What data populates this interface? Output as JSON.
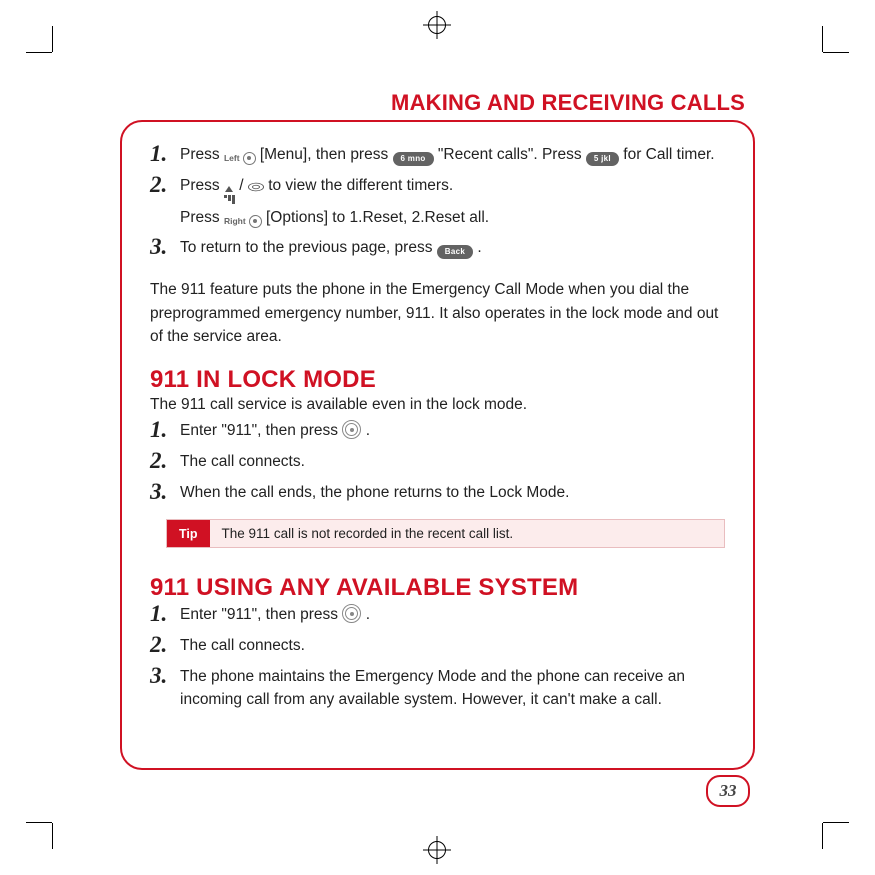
{
  "header": {
    "title": "MAKING AND RECEIVING CALLS"
  },
  "glyphs": {
    "left_soft": "Left",
    "right_soft": "Right",
    "key6": "6 mno",
    "key5": "5 jkl",
    "back": "Back"
  },
  "top_steps": {
    "s1": {
      "a": "Press",
      "b": "[Menu], then press",
      "c": "\"Recent calls\".  Press",
      "d": "for Call timer."
    },
    "s2": {
      "a": "Press",
      "b": "/",
      "c": "to view the different timers.",
      "sub_a": "Press",
      "sub_b": "[Options] to 1.Reset, 2.Reset all."
    },
    "s3": {
      "a": "To return to the previous page, press",
      "b": "."
    }
  },
  "intro_para": "The 911 feature puts the phone in the Emergency Call Mode when you dial the preprogrammed emergency number, 911.  It also operates in the lock mode and out of the service area.",
  "section_lock": {
    "title": "911 IN LOCK MODE",
    "subtitle": "The 911 call service is available even in the lock mode.",
    "s1": {
      "a": "Enter \"911\", then press",
      "b": "."
    },
    "s2": "The call connects.",
    "s3": "When the call ends, the phone returns to the Lock Mode."
  },
  "tip": {
    "label": "Tip",
    "text": "The 911 call is not recorded in the recent call list."
  },
  "section_any": {
    "title": "911 USING ANY AVAILABLE SYSTEM",
    "s1": {
      "a": "Enter \"911\", then press",
      "b": "."
    },
    "s2": "The call connects.",
    "s3": "The phone maintains the Emergency Mode and the phone can receive an incoming call from any available system.  However, it can't make a call."
  },
  "page_number": "33",
  "chart_data": {
    "type": "table",
    "title": "Phone manual page 33 — Making and Receiving Calls",
    "sections": [
      {
        "heading": null,
        "steps": [
          "Press Left-softkey [Menu], then press key 6 (mno) \"Recent calls\". Press key 5 (jkl) for Call timer.",
          "Press up/down to view the different timers. Press Right-softkey [Options] to 1.Reset, 2.Reset all.",
          "To return to the previous page, press Back."
        ]
      },
      {
        "heading": "911 IN LOCK MODE",
        "intro": "The 911 call service is available even in the lock mode.",
        "steps": [
          "Enter \"911\", then press Call.",
          "The call connects.",
          "When the call ends, the phone returns to the Lock Mode."
        ],
        "tip": "The 911 call is not recorded in the recent call list."
      },
      {
        "heading": "911 USING ANY AVAILABLE SYSTEM",
        "steps": [
          "Enter \"911\", then press Call.",
          "The call connects.",
          "The phone maintains the Emergency Mode and the phone can receive an incoming call from any available system. However, it can't make a call."
        ]
      }
    ]
  }
}
